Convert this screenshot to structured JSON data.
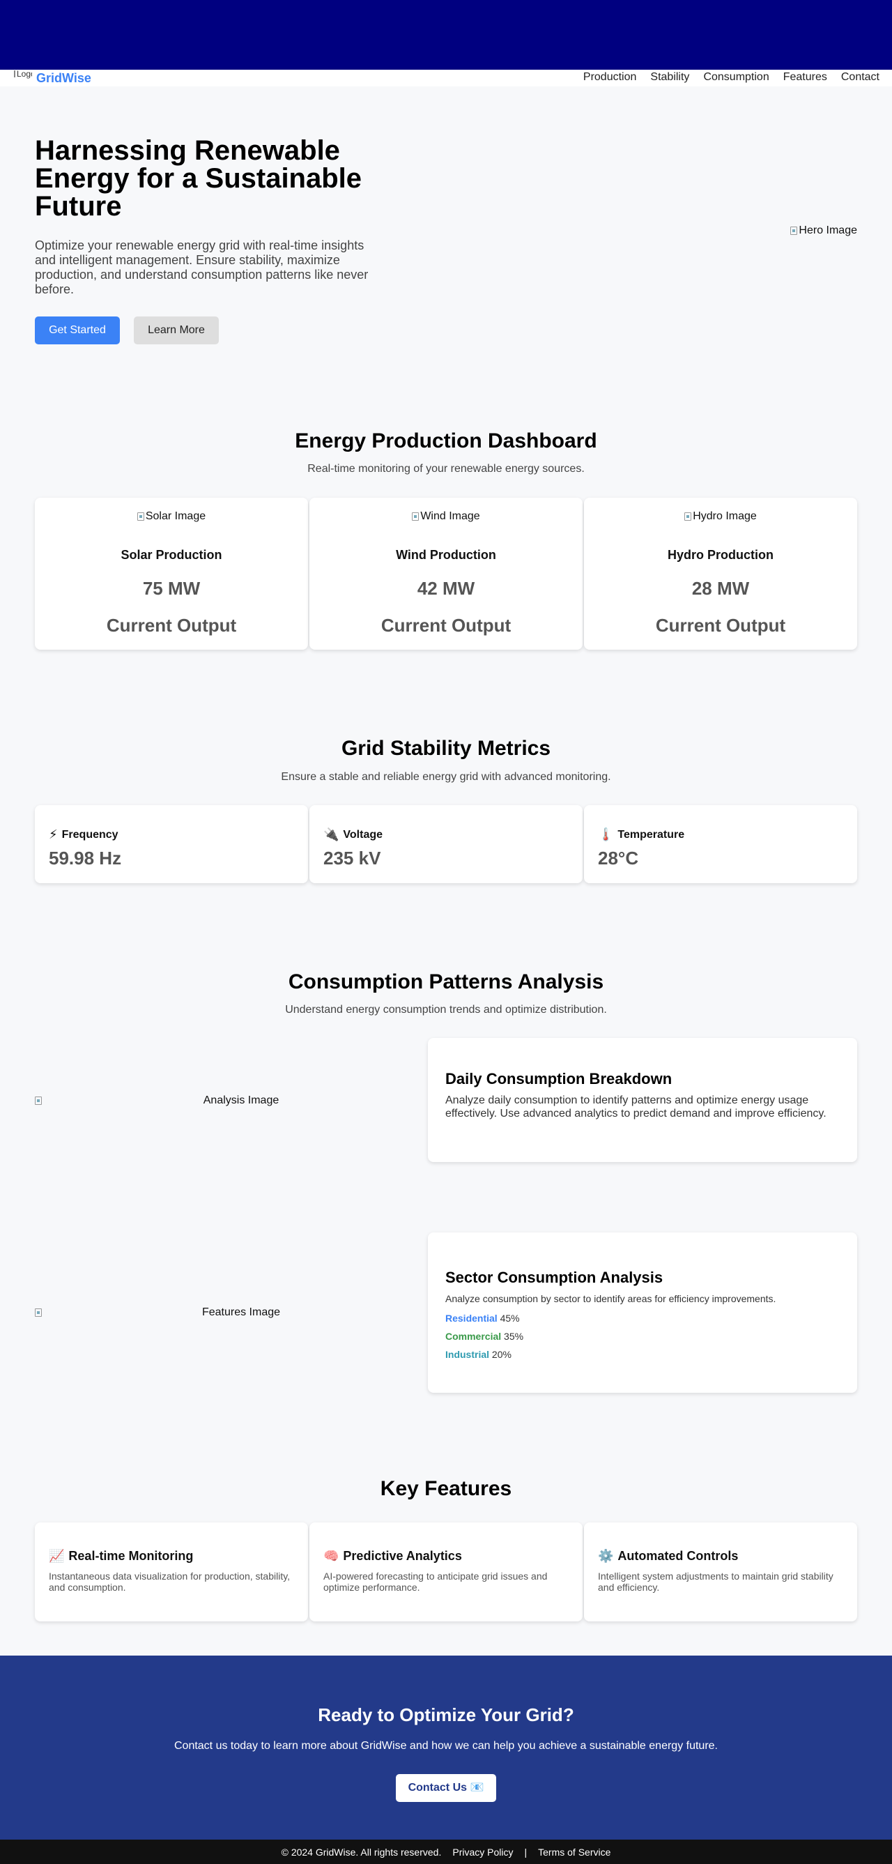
{
  "header": {
    "logo_alt": "Logo",
    "brand": "GridWise",
    "nav": [
      "Production",
      "Stability",
      "Consumption",
      "Features",
      "Contact"
    ]
  },
  "hero": {
    "title": "Harnessing Renewable Energy for a Sustainable Future",
    "text": "Optimize your renewable energy grid with real-time insights and intelligent management. Ensure stability, maximize production, and understand consumption patterns like never before.",
    "primary_button": "Get Started",
    "secondary_button": "Learn More",
    "image_alt": "Hero Image"
  },
  "production": {
    "title": "Energy Production Dashboard",
    "subtitle": "Real-time monitoring of your renewable energy sources.",
    "cards": [
      {
        "image_alt": "Solar Image",
        "name": "Solar Production",
        "value": "75 MW",
        "label": "Current Output"
      },
      {
        "image_alt": "Wind Image",
        "name": "Wind Production",
        "value": "42 MW",
        "label": "Current Output"
      },
      {
        "image_alt": "Hydro Image",
        "name": "Hydro Production",
        "value": "28 MW",
        "label": "Current Output"
      }
    ]
  },
  "stability": {
    "title": "Grid Stability Metrics",
    "subtitle": "Ensure a stable and reliable energy grid with advanced monitoring.",
    "metrics": [
      {
        "icon": "⚡",
        "name": "Frequency",
        "value": "59.98 Hz"
      },
      {
        "icon": "🔌",
        "name": "Voltage",
        "value": "235 kV"
      },
      {
        "icon": "🌡️",
        "name": "Temperature",
        "value": "28°C"
      }
    ]
  },
  "consumption": {
    "title": "Consumption Patterns Analysis",
    "subtitle": "Understand energy consumption trends and optimize distribution.",
    "analysis_image_alt": "Analysis Image",
    "daily": {
      "title": "Daily Consumption Breakdown",
      "text": "Analyze daily consumption to identify patterns and optimize energy usage effectively. Use advanced analytics to predict demand and improve efficiency."
    },
    "features_image_alt": "Features Image",
    "sector": {
      "title": "Sector Consumption Analysis",
      "text": "Analyze consumption by sector to identify areas for efficiency improvements.",
      "items": [
        {
          "name": "Residential",
          "value": "45%",
          "color": "#3b82f6"
        },
        {
          "name": "Commercial",
          "value": "35%",
          "color": "#3a9a4a"
        },
        {
          "name": "Industrial",
          "value": "20%",
          "color": "#2f9bb0"
        }
      ]
    }
  },
  "features": {
    "title": "Key Features",
    "items": [
      {
        "icon": "📈",
        "name": "Real-time Monitoring",
        "desc": "Instantaneous data visualization for production, stability, and consumption."
      },
      {
        "icon": "🧠",
        "name": "Predictive Analytics",
        "desc": "AI-powered forecasting to anticipate grid issues and optimize performance."
      },
      {
        "icon": "⚙️",
        "name": "Automated Controls",
        "desc": "Intelligent system adjustments to maintain grid stability and efficiency."
      }
    ]
  },
  "cta": {
    "title": "Ready to Optimize Your Grid?",
    "text": "Contact us today to learn more about GridWise and how we can help you achieve a sustainable energy future.",
    "button": "Contact Us 📧"
  },
  "footer": {
    "copyright": "© 2024 GridWise. All rights reserved.",
    "privacy": "Privacy Policy",
    "separator": "|",
    "terms": "Terms of Service"
  },
  "colors": {
    "topbar": "#000080",
    "accent": "#3b82f6",
    "cta_bg": "#233a8a",
    "footer_bg": "#111111"
  }
}
